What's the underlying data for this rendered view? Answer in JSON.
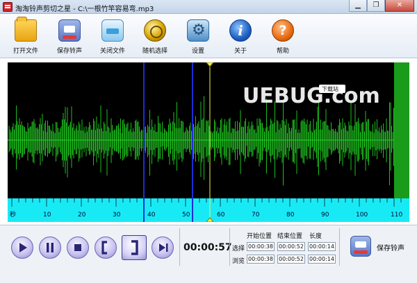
{
  "window": {
    "title": "淘淘铃声剪切之星 - C:\\一根竹竿容易弯.mp3",
    "controls": [
      "▁",
      "❐",
      "✕"
    ]
  },
  "toolbar": {
    "items": [
      {
        "label": "打开文件",
        "icon": "open-folder-icon"
      },
      {
        "label": "保存铃声",
        "icon": "save-ringtone-icon"
      },
      {
        "label": "关闭文件",
        "icon": "close-file-icon"
      },
      {
        "label": "随机选择",
        "icon": "random-select-icon"
      },
      {
        "label": "设置",
        "icon": "settings-icon"
      },
      {
        "label": "关于",
        "icon": "about-icon",
        "glyph": "i"
      },
      {
        "label": "帮助",
        "icon": "help-icon",
        "glyph": "?"
      }
    ]
  },
  "waveform": {
    "watermark": "UEBUG.com",
    "watermark_tag": "下载站",
    "axis_unit": "秒",
    "ticks": [
      "10",
      "20",
      "30",
      "40",
      "50",
      "60",
      "70",
      "80",
      "90",
      "100",
      "110"
    ],
    "selection_start_sec": 38,
    "selection_end_sec": 52,
    "playhead_sec": 57,
    "colors": {
      "background": "#000000",
      "wave": "#1fbf1f",
      "ruler": "#00f0ff",
      "selection": "#1a2fd8",
      "playhead": "#f2f24a"
    }
  },
  "player": {
    "buttons": [
      {
        "name": "play-button",
        "icon": "play-icon"
      },
      {
        "name": "pause-button",
        "icon": "pause-icon"
      },
      {
        "name": "stop-button",
        "icon": "stop-icon"
      },
      {
        "name": "set-start-button",
        "icon": "left-bracket-icon"
      },
      {
        "name": "set-end-button",
        "icon": "right-bracket-icon"
      },
      {
        "name": "play-selection-button",
        "icon": "play-to-end-icon"
      }
    ],
    "current_time": "00:00:57"
  },
  "positions": {
    "headers": {
      "start": "开始位置",
      "end": "结束位置",
      "length": "长度"
    },
    "selection": {
      "label": "选择",
      "start": "00:00:38",
      "end": "00:00:52",
      "length": "00:00:14"
    },
    "preview": {
      "label": "浏览",
      "start": "00:00:38",
      "end": "00:00:52",
      "length": "00:00:14"
    }
  },
  "save_button": {
    "label": "保存铃声"
  }
}
